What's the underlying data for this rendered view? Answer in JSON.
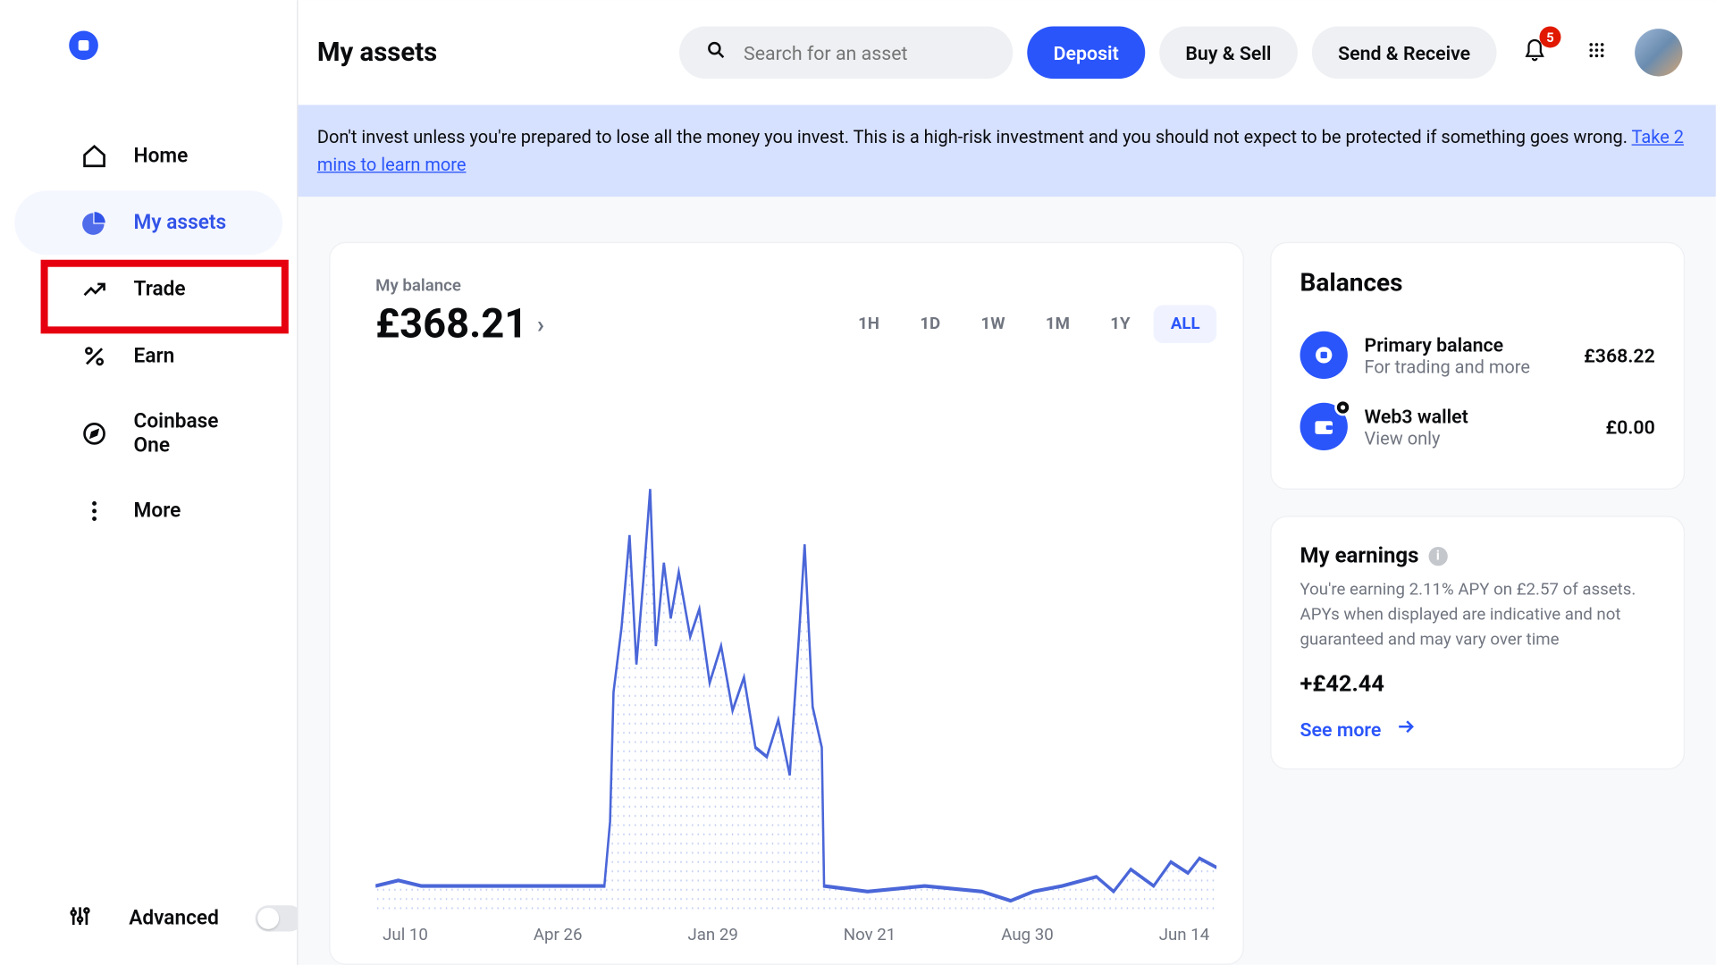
{
  "page_title": "My assets",
  "search": {
    "placeholder": "Search for an asset"
  },
  "header_buttons": {
    "deposit": "Deposit",
    "buy_sell": "Buy & Sell",
    "send_receive": "Send & Receive"
  },
  "notification_count": "5",
  "banner": {
    "text_prefix": "Don't invest unless you're prepared to lose all the money you invest. This is a high-risk investment and you should not expect to be protected if something goes wrong. ",
    "link_text": "Take 2 mins to learn more"
  },
  "sidebar": {
    "items": [
      {
        "label": "Home",
        "icon": "home"
      },
      {
        "label": "My assets",
        "icon": "pie"
      },
      {
        "label": "Trade",
        "icon": "trend"
      },
      {
        "label": "Earn",
        "icon": "percent"
      },
      {
        "label": "Coinbase One",
        "icon": "compass"
      },
      {
        "label": "More",
        "icon": "dots"
      }
    ],
    "advanced_label": "Advanced"
  },
  "balance": {
    "label": "My balance",
    "value": "£368.21"
  },
  "range_tabs": [
    "1H",
    "1D",
    "1W",
    "1M",
    "1Y",
    "ALL"
  ],
  "active_range": "ALL",
  "chart_data": {
    "type": "area",
    "x_labels": [
      "Jul 10",
      "Apr 26",
      "Jan 29",
      "Nov 21",
      "Aug 30",
      "Jun 14"
    ],
    "series": [
      {
        "name": "Balance",
        "values_path": "M0,285 L20,282 L40,285 L90,285 L180,285 L200,285 L205,250 L208,180 L215,145 L222,95 L228,165 L234,120 L240,70 L245,155 L252,110 L258,140 L265,115 L275,150 L283,135 L292,175 L302,155 L312,190 L322,172 L332,210 L342,215 L352,195 L362,225 L370,150 L375,100 L382,188 L390,210 L392,285 L430,288 L480,285 L530,288 L555,293 L575,288 L600,285 L630,280 L645,288 L660,276 L680,285 L695,272 L710,278 L720,270 L735,275"
      }
    ],
    "ylim_approx": [
      0,
      800
    ],
    "ylabel": "",
    "xlabel": "",
    "title": ""
  },
  "balances_card": {
    "title": "Balances",
    "items": [
      {
        "name": "Primary balance",
        "sub": "For trading and more",
        "amount": "£368.22",
        "icon": "coinbase"
      },
      {
        "name": "Web3 wallet",
        "sub": "View only",
        "amount": "£0.00",
        "icon": "wallet"
      }
    ]
  },
  "earnings_card": {
    "title": "My earnings",
    "desc": "You're earning 2.11% APY on £2.57 of assets. APYs when displayed are indicative and not guaranteed and may vary over time",
    "amount": "+£42.44",
    "see_more": "See more"
  }
}
